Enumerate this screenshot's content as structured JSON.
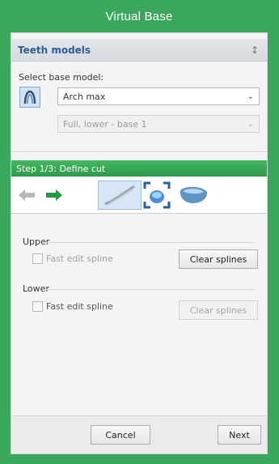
{
  "window": {
    "title": "Virtual Base"
  },
  "teeth_models": {
    "header": "Teeth models",
    "collapse_glyph": "↕",
    "select_label": "Select base model:",
    "model_dropdown": {
      "value": "Arch max"
    },
    "sub_dropdown": {
      "value": "Full, lower - base 1"
    }
  },
  "step": {
    "title": "Step 1/3: Define cut"
  },
  "toolbar": {
    "icons": [
      "back-arrow-icon",
      "forward-arrow-icon",
      "spline-tool-icon",
      "view-fit-icon",
      "base-shape-icon"
    ]
  },
  "upper": {
    "label": "Upper",
    "fast_edit_label": "Fast edit spline",
    "clear_label": "Clear splines"
  },
  "lower": {
    "label": "Lower",
    "fast_edit_label": "Fast edit spline",
    "clear_label": "Clear splines"
  },
  "footer": {
    "cancel_label": "Cancel",
    "next_label": "Next"
  },
  "colors": {
    "title_bar": "#3aa85c",
    "step_bar": "#34a853",
    "section_title": "#2a5d99"
  }
}
